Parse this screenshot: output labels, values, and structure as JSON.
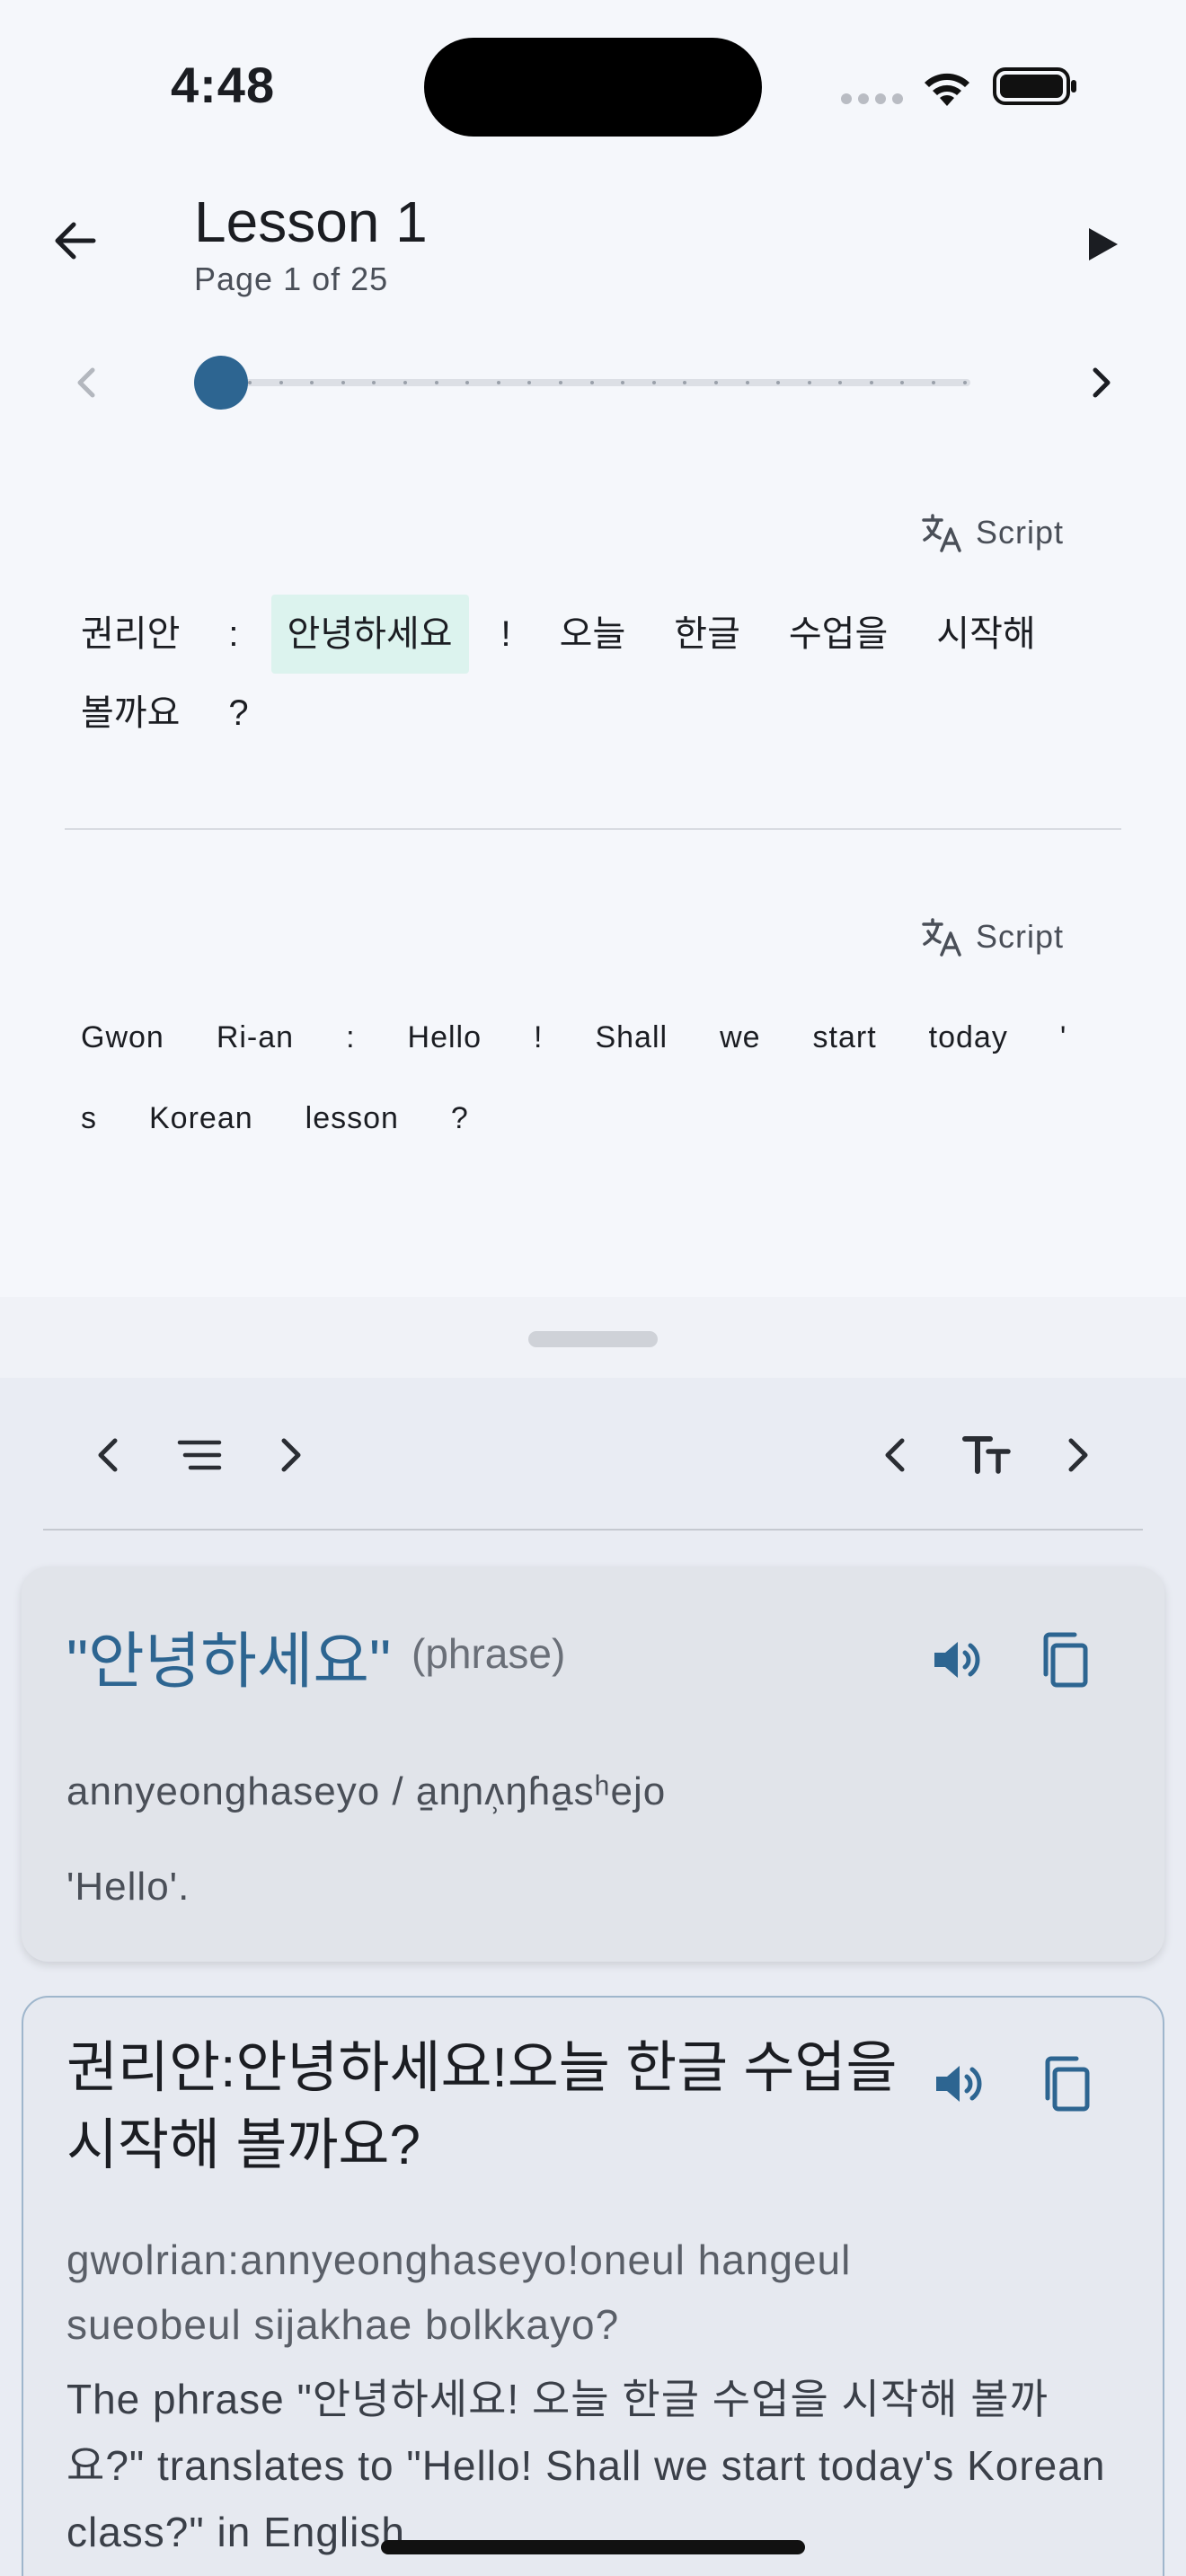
{
  "status_bar": {
    "time": "4:48"
  },
  "header": {
    "title": "Lesson 1",
    "subtitle": "Page 1 of 25"
  },
  "slider": {
    "current_page": 1,
    "total_pages": 25
  },
  "script_label": "Script",
  "korean_tokens": [
    "권리안",
    ":",
    "안녕하세요",
    "!",
    "오늘",
    "한글",
    "수업을",
    "시작해",
    "볼까요",
    "?"
  ],
  "highlighted_token_index": 2,
  "english_tokens": [
    "Gwon",
    "Ri-an",
    ":",
    "Hello",
    "!",
    "Shall",
    "we",
    "start",
    "today",
    "'",
    "s",
    "Korean",
    "lesson",
    "?"
  ],
  "word_card": {
    "word": "\"안녕하세요\"",
    "part_of_speech": "(phrase)",
    "romanization": "annyeonghaseyo / a̠nɲʌ̹ŋɦa̠sʰejo",
    "gloss": "'Hello'."
  },
  "sentence_card": {
    "sentence": "권리안:안녕하세요!오늘 한글 수업을 시작해 볼까요?",
    "romanization": "gwolrian:annyeonghaseyo!oneul hangeul sueobeul sijakhae bolkkayo?",
    "explanation": "The phrase \"안녕하세요! 오늘 한글 수업을 시작해 볼까요?\" translates to \"Hello! Shall we start today's Korean class?\" in English."
  },
  "colors": {
    "accent": "#2d6591",
    "highlight": "#dcf3ee",
    "background": "#f5f7fb",
    "sheet": "#e9ecf3"
  }
}
